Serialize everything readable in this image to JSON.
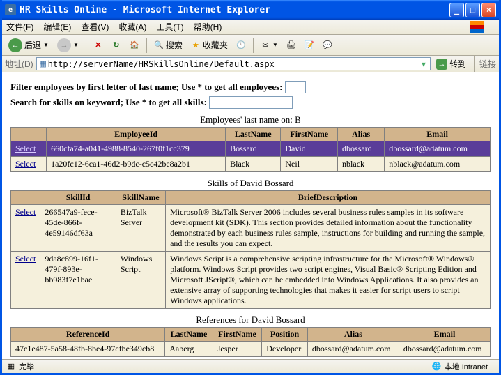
{
  "window": {
    "title": "HR Skills Online - Microsoft Internet Explorer"
  },
  "menu": {
    "file": "文件(F)",
    "edit": "编辑(E)",
    "view": "查看(V)",
    "favorites": "收藏(A)",
    "tools": "工具(T)",
    "help": "帮助(H)"
  },
  "toolbar": {
    "back": "后退",
    "search": "搜索",
    "favorites": "收藏夹"
  },
  "addressbar": {
    "label": "地址(D)",
    "url": "http://serverName/HRSkillsOnline/Default.aspx",
    "go": "转到",
    "links": "链接"
  },
  "filters": {
    "line1": "Filter employees by first letter of last name; Use * to get all employees:",
    "line2": "Search for skills on keyword; Use * to get all skills:"
  },
  "employees": {
    "caption": "Employees' last name on: B",
    "headers": {
      "id": "EmployeeId",
      "last": "LastName",
      "first": "FirstName",
      "alias": "Alias",
      "email": "Email"
    },
    "select_label": "Select",
    "rows": [
      {
        "selected": true,
        "id": "660cfa74-a041-4988-8540-267f0f1cc379",
        "last": "Bossard",
        "first": "David",
        "alias": "dbossard",
        "email": "dbossard@adatum.com"
      },
      {
        "selected": false,
        "id": "1a20fc12-6ca1-46d2-b9dc-c5c42be8a2b1",
        "last": "Black",
        "first": "Neil",
        "alias": "nblack",
        "email": "nblack@adatum.com"
      }
    ]
  },
  "skills": {
    "caption": "Skills of David Bossard",
    "headers": {
      "id": "SkillId",
      "name": "SkillName",
      "desc": "BriefDescription"
    },
    "select_label": "Select",
    "rows": [
      {
        "id": "266547a9-fece-45de-866f-4e59146df63a",
        "name": "BizTalk Server",
        "desc": "Microsoft® BizTalk Server 2006 includes several business rules samples in its software development kit (SDK). This section provides detailed information about the functionality demonstrated by each business rules sample, instructions for building and running the sample, and the results you can expect."
      },
      {
        "id": "9da8c899-16f1-479f-893e-bb983f7e1bae",
        "name": "Windows Script",
        "desc": "Windows Script is a comprehensive scripting infrastructure for the Microsoft® Windows® platform. Windows Script provides two script engines, Visual Basic® Scripting Edition and Microsoft JScript®, which can be embedded into Windows Applications. It also provides an extensive array of supporting technologies that makes it easier for script users to script Windows applications."
      }
    ]
  },
  "references": {
    "caption": "References for David Bossard",
    "headers": {
      "id": "ReferenceId",
      "last": "LastName",
      "first": "FirstName",
      "pos": "Position",
      "alias": "Alias",
      "email": "Email"
    },
    "rows": [
      {
        "id": "47c1e487-5a58-48fb-8be4-97cfbe349cb8",
        "last": "Aaberg",
        "first": "Jesper",
        "pos": "Developer",
        "alias": "dbossard@adatum.com",
        "email": "dbossard@adatum.com"
      }
    ]
  },
  "status": {
    "done": "完毕",
    "zone": "本地 Intranet"
  }
}
